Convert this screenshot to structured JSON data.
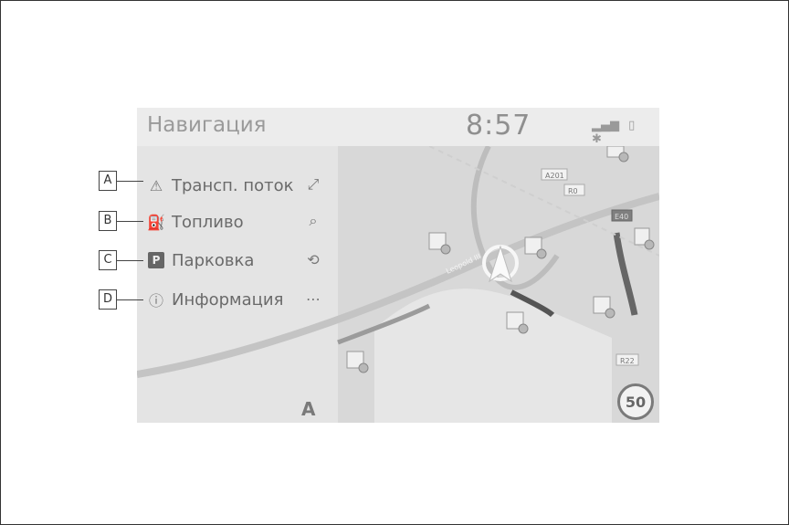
{
  "statusbar": {
    "title": "Навигация",
    "time": "8:57",
    "icons": [
      "signal-icon",
      "battery-icon",
      "bluetooth-icon"
    ]
  },
  "menu": [
    {
      "callout": "A",
      "label": "Трансп. поток",
      "icon": "traffic-warning-icon",
      "side_icon": "fullscreen-icon"
    },
    {
      "callout": "B",
      "label": "Топливо",
      "icon": "fuel-pump-icon",
      "side_icon": "search-icon"
    },
    {
      "callout": "C",
      "label": "Парковка",
      "icon": "parking-icon",
      "side_icon": "north-up-rotate-icon"
    },
    {
      "callout": "D",
      "label": "Информация",
      "icon": "info-icon",
      "side_icon": "more-icon"
    }
  ],
  "map": {
    "road_labels": [
      "A201",
      "R0",
      "E40",
      "R22"
    ],
    "street_label": "Leopold III",
    "speed_limit": "50",
    "lane_indicator": "A"
  }
}
